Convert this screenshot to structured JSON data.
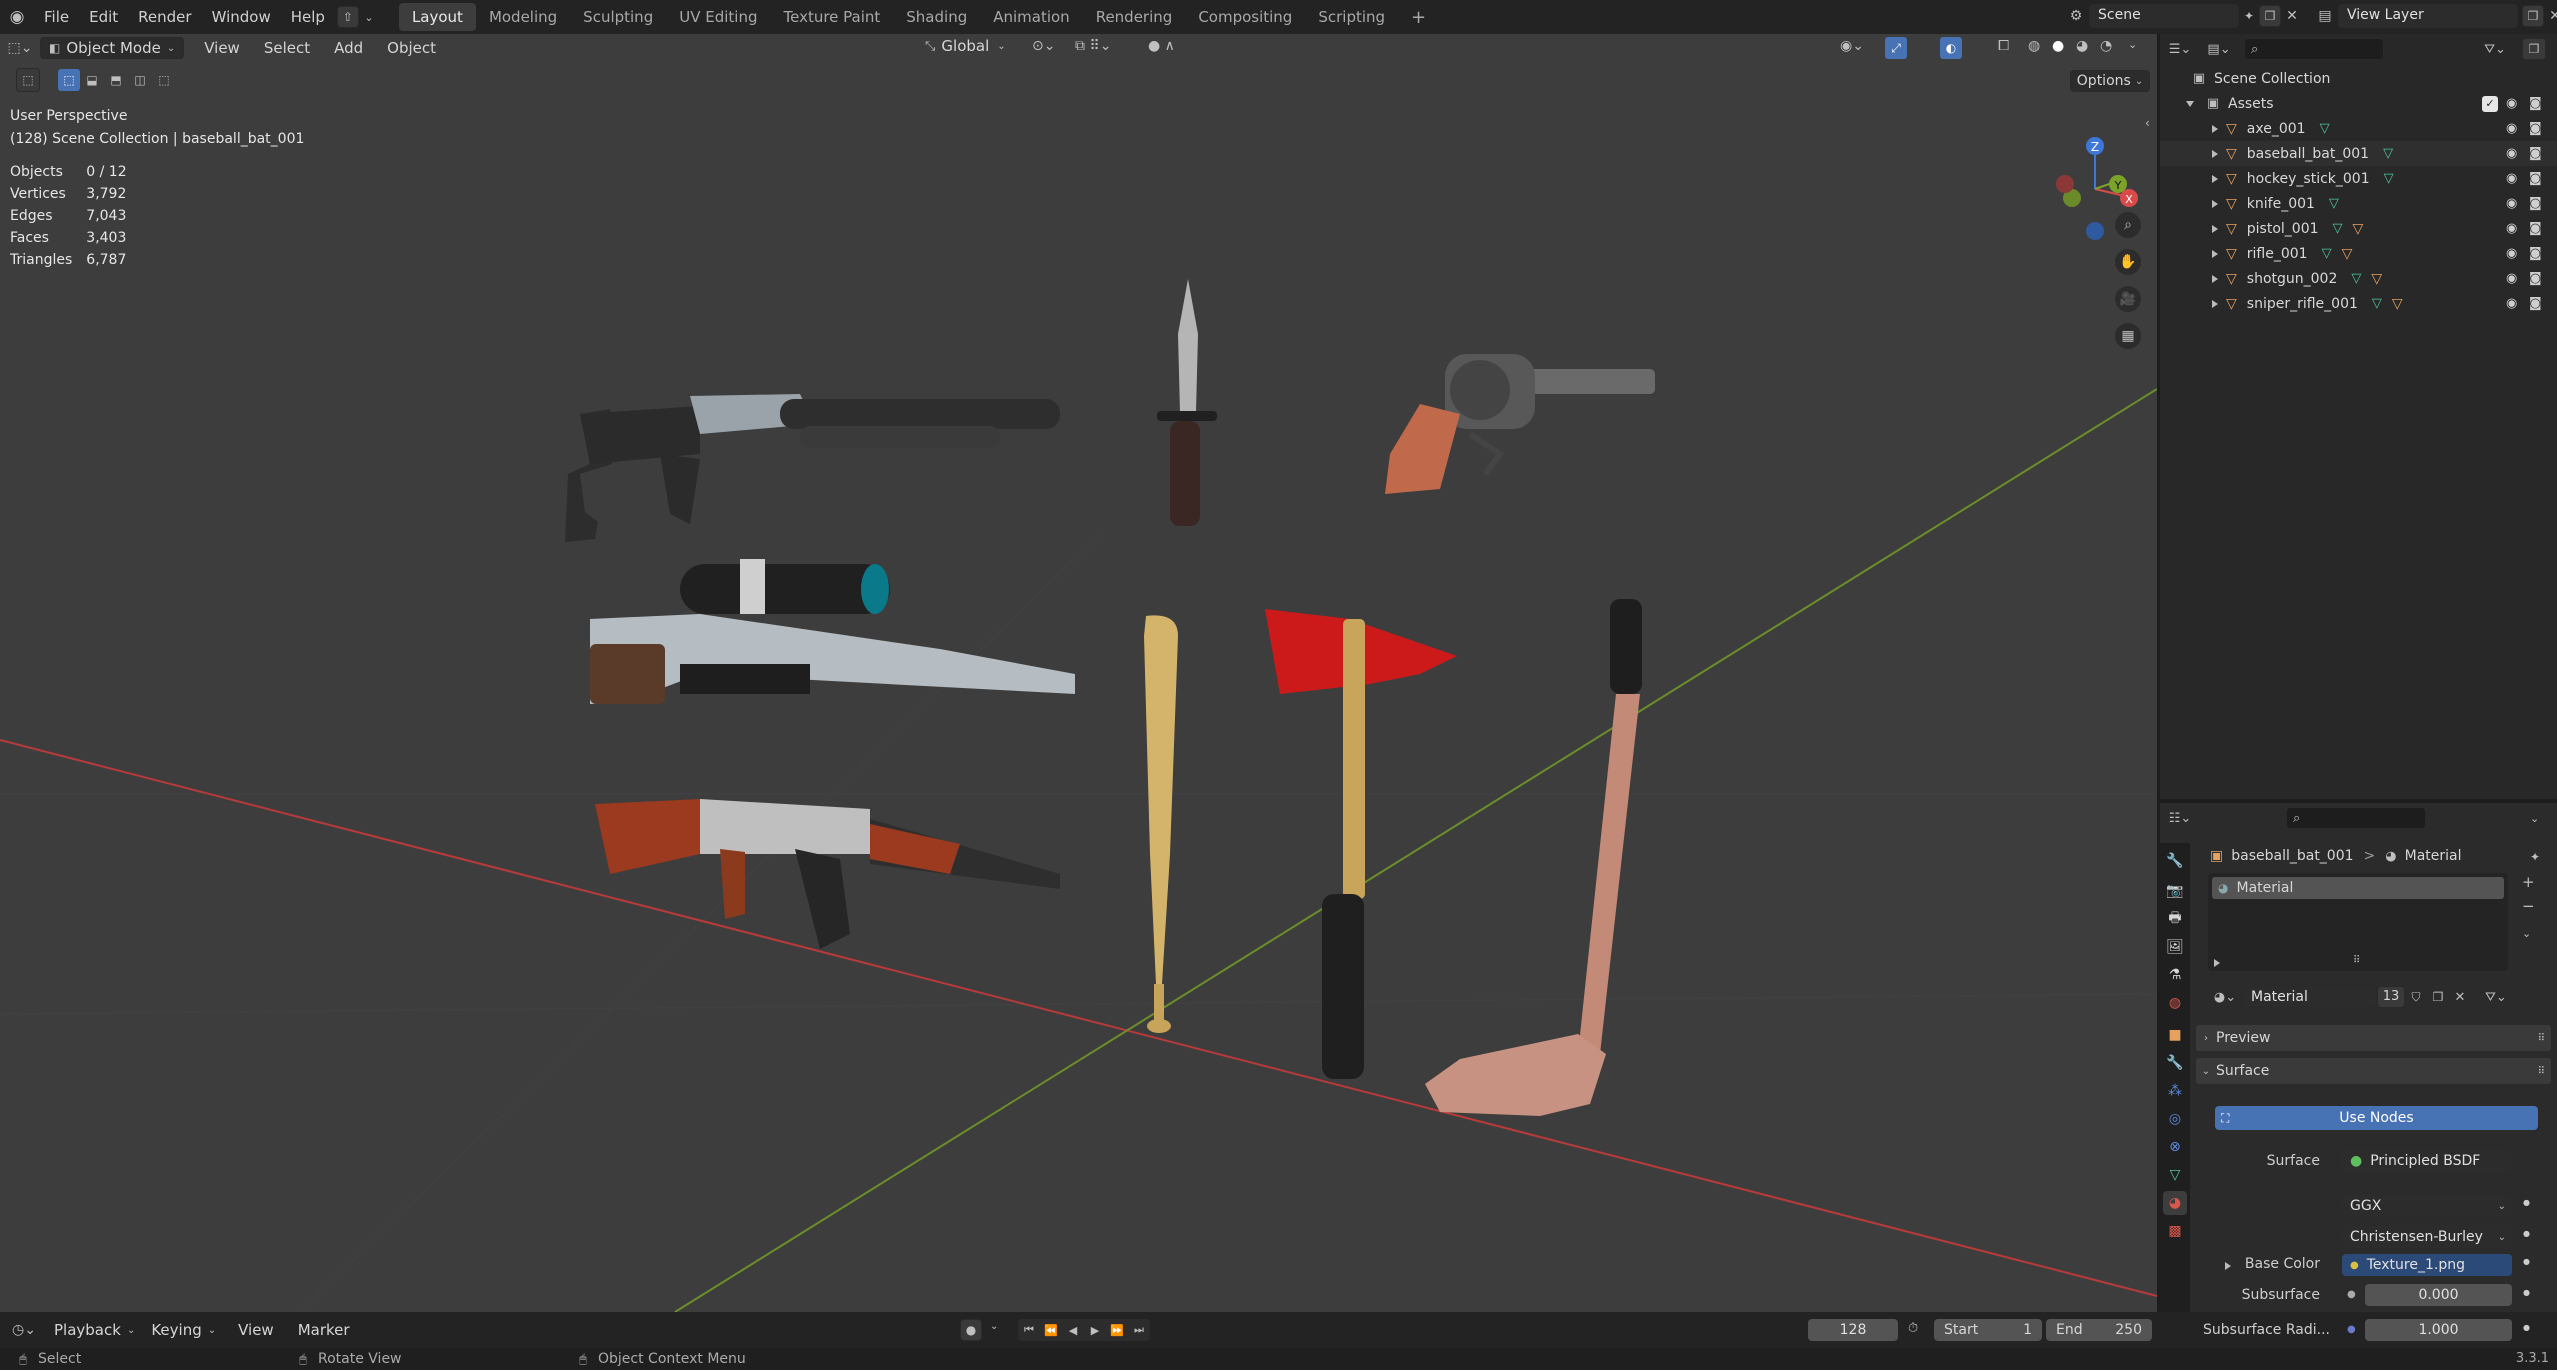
{
  "topbar": {
    "menus": [
      "File",
      "Edit",
      "Render",
      "Window",
      "Help"
    ],
    "workspaces": [
      "Layout",
      "Modeling",
      "Sculpting",
      "UV Editing",
      "Texture Paint",
      "Shading",
      "Animation",
      "Rendering",
      "Compositing",
      "Scripting"
    ],
    "active_workspace": "Layout",
    "add_tab": "+",
    "scene": "Scene",
    "view_layer": "View Layer"
  },
  "viewport": {
    "mode": "Object Mode",
    "menus": [
      "View",
      "Select",
      "Add",
      "Object"
    ],
    "orientation": "Global",
    "options": "Options",
    "perspective": "User Perspective",
    "collection_info": "(128) Scene Collection | baseball_bat_001",
    "stats": [
      {
        "label": "Objects",
        "value": "0 / 12"
      },
      {
        "label": "Vertices",
        "value": "3,792"
      },
      {
        "label": "Edges",
        "value": "7,043"
      },
      {
        "label": "Faces",
        "value": "3,403"
      },
      {
        "label": "Triangles",
        "value": "6,787"
      }
    ],
    "gizmo": {
      "z": "Z",
      "y": "Y",
      "x": "X"
    }
  },
  "outliner": {
    "root": "Scene Collection",
    "collection": "Assets",
    "items": [
      "axe_001",
      "baseball_bat_001",
      "hockey_stick_001",
      "knife_001",
      "pistol_001",
      "rifle_001",
      "shotgun_002",
      "sniper_rifle_001"
    ]
  },
  "properties": {
    "breadcrumb_object": "baseball_bat_001",
    "breadcrumb_sep": ">",
    "breadcrumb_material": "Material",
    "slot": "Material",
    "material_name": "Material",
    "users": "13",
    "preview": "Preview",
    "surface_panel": "Surface",
    "use_nodes": "Use Nodes",
    "surface_label": "Surface",
    "surface_value": "Principled BSDF",
    "distribution": "GGX",
    "subsurface_method": "Christensen-Burley",
    "base_color_label": "Base Color",
    "base_color_value": "Texture_1.png",
    "subsurface_label": "Subsurface",
    "subsurface_value": "0.000",
    "subsurface_radius_label": "Subsurface Radi...",
    "subsurface_radius_value": "1.000"
  },
  "timeline": {
    "menus": [
      "Playback",
      "Keying",
      "View",
      "Marker"
    ],
    "current_frame": "128",
    "start_label": "Start",
    "start_value": "1",
    "end_label": "End",
    "end_value": "250"
  },
  "statusbar": {
    "select": "Select",
    "rotate": "Rotate View",
    "context": "Object Context Menu",
    "version": "3.3.1"
  },
  "colors": {
    "accent": "#4772b3",
    "axe_head": "#d01c1c",
    "bat": "#d8b76a",
    "wood": "#b4502a",
    "hockey": "#c89282"
  }
}
